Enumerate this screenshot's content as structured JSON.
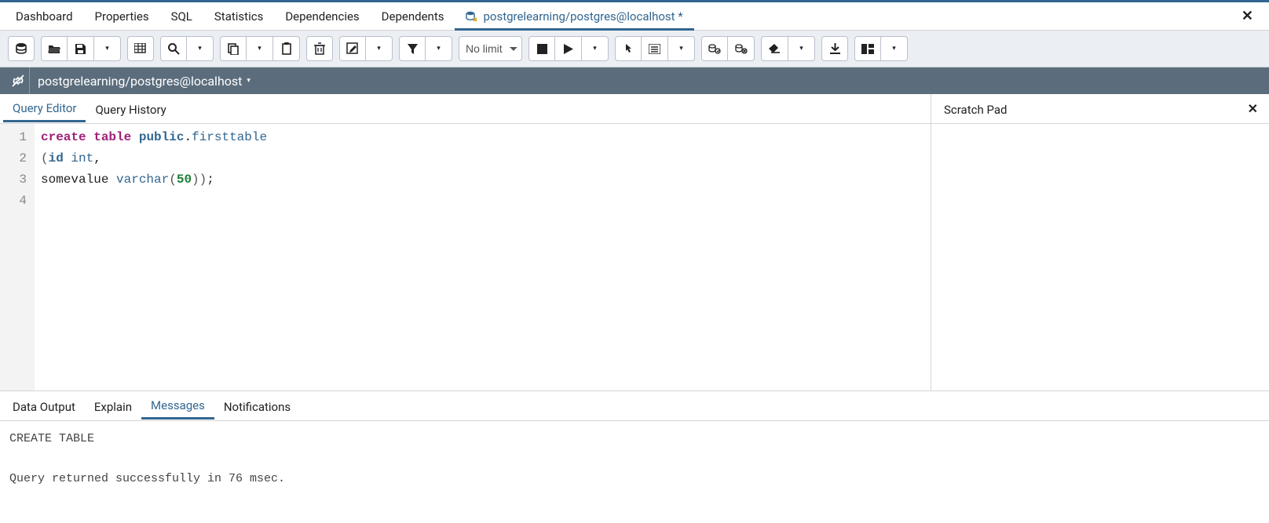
{
  "topnav": {
    "tabs": [
      "Dashboard",
      "Properties",
      "SQL",
      "Statistics",
      "Dependencies",
      "Dependents"
    ],
    "active_tab_label": "postgrelearning/postgres@localhost *"
  },
  "toolbar": {
    "limit_selected": "No limit"
  },
  "connection": {
    "label": "postgrelearning/postgres@localhost"
  },
  "editor_tabs": {
    "query_editor": "Query Editor",
    "query_history": "Query History"
  },
  "scratch": {
    "title": "Scratch Pad"
  },
  "code": {
    "gutter": [
      "1",
      "2",
      "3",
      "4"
    ],
    "line1": {
      "create": "create",
      "table": "table",
      "public": "public",
      "dot": ".",
      "first": "firsttable"
    },
    "line2": {
      "open": "(",
      "id": "id",
      "int": "int",
      "comma": ","
    },
    "line3": {
      "some": "somevalue ",
      "varchar": "varchar",
      "open": "(",
      "num": "50",
      "close": ")",
      ")": ")",
      ";": ";"
    }
  },
  "output_tabs": {
    "data_output": "Data Output",
    "explain": "Explain",
    "messages": "Messages",
    "notifications": "Notifications"
  },
  "messages": {
    "line1": "CREATE TABLE",
    "line2": "Query returned successfully in 76 msec."
  }
}
